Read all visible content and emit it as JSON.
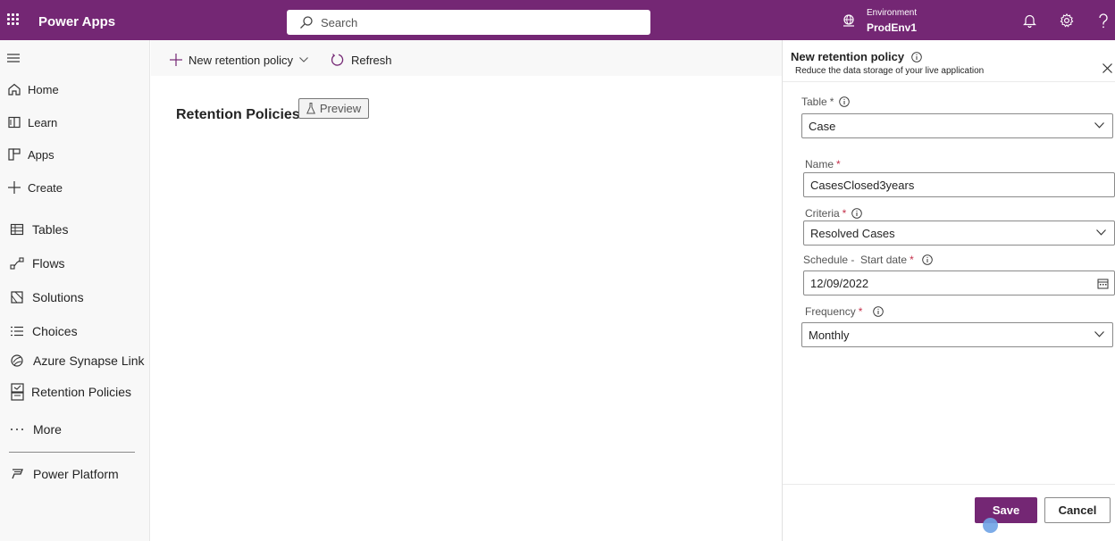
{
  "header": {
    "app_title": "Power Apps",
    "search_placeholder": "Search",
    "environment_label": "Environment",
    "environment_name": "ProdEnv1"
  },
  "nav": {
    "items": [
      {
        "label": "Home",
        "icon": "home-icon"
      },
      {
        "label": "Learn",
        "icon": "book-icon"
      },
      {
        "label": "Apps",
        "icon": "apps-icon"
      },
      {
        "label": "Create",
        "icon": "plus-icon"
      },
      {
        "label": "Tables",
        "icon": "table-icon"
      },
      {
        "label": "Flows",
        "icon": "flow-icon"
      },
      {
        "label": "Solutions",
        "icon": "solutions-icon"
      },
      {
        "label": "Choices",
        "icon": "list-icon"
      },
      {
        "label": "Azure Synapse Link",
        "icon": "synapse-icon"
      },
      {
        "label": "Retention Policies",
        "icon": "retention-icon"
      },
      {
        "label": "More",
        "icon": "ellipsis-icon"
      },
      {
        "label": "Power Platform",
        "icon": "power-platform-icon"
      }
    ]
  },
  "commandbar": {
    "new_label": "New retention policy",
    "refresh_label": "Refresh"
  },
  "main": {
    "title": "Retention Policies",
    "badge": "Preview"
  },
  "panel": {
    "title": "New retention policy",
    "subtitle": "Reduce the data storage of your live application",
    "fields": {
      "table": {
        "label": "Table",
        "required_mark": "*",
        "value": "Case"
      },
      "name": {
        "label": "Name",
        "required_mark": "*",
        "value": "CasesClosed3years"
      },
      "criteria": {
        "label": "Criteria",
        "required_mark": "*",
        "value": "Resolved Cases"
      },
      "schedule": {
        "label": "Schedule -  Start date",
        "required_mark": "*",
        "value": "12/09/2022"
      },
      "frequency": {
        "label": "Frequency",
        "required_mark": "*",
        "value": "Monthly"
      }
    },
    "save_label": "Save",
    "cancel_label": "Cancel"
  },
  "colors": {
    "brand": "#742774",
    "required": "#c4314b"
  }
}
